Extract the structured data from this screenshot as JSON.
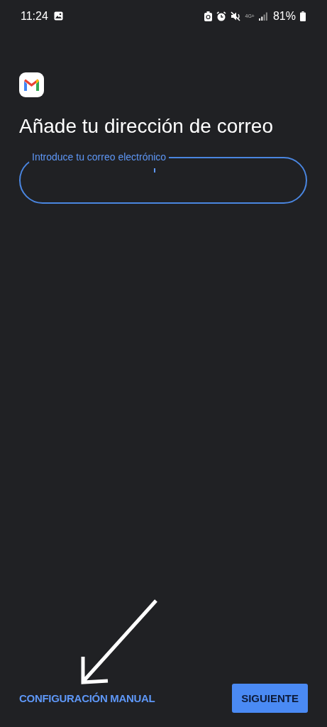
{
  "status_bar": {
    "time": "11:24",
    "network": "4G+",
    "battery": "81%"
  },
  "title": "Añade tu dirección de correo",
  "email_field": {
    "label": "Introduce tu correo electrónico",
    "focused": true
  },
  "actions": {
    "link": "CONFIGURACIÓN MANUAL",
    "button": "SIGUIENTE"
  }
}
